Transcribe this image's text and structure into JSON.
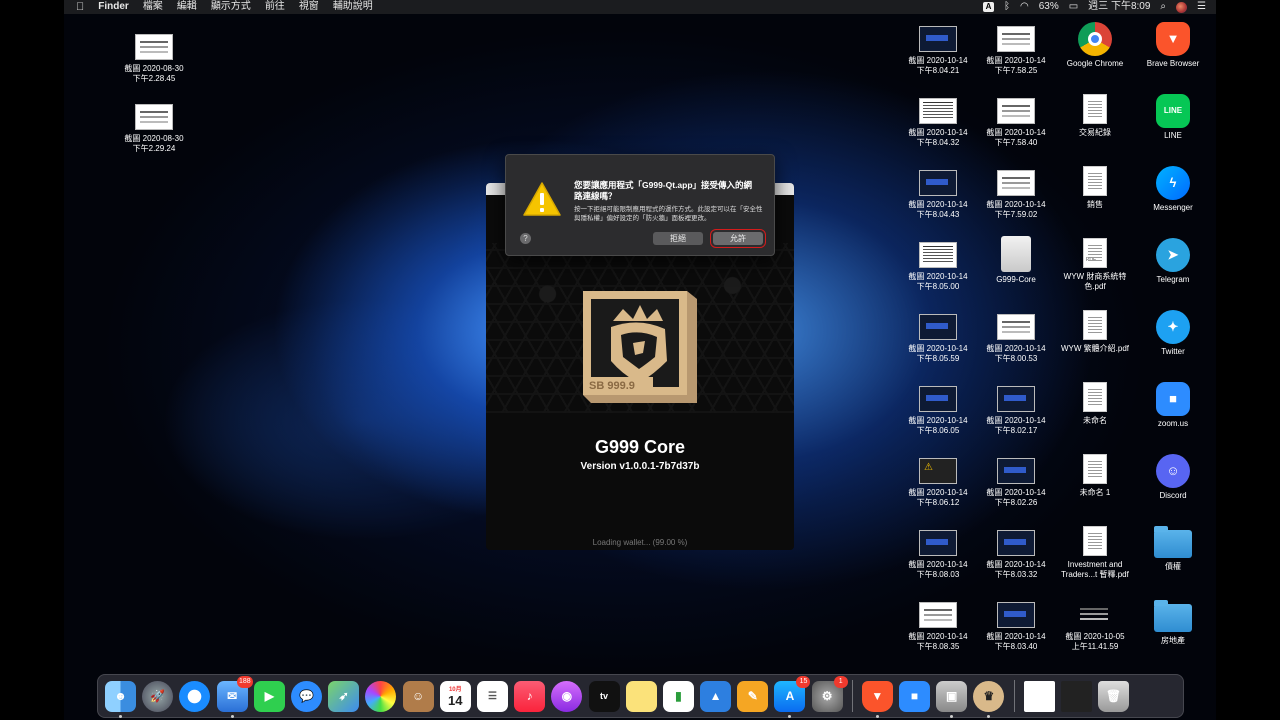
{
  "menubar": {
    "apple": "",
    "app_name": "Finder",
    "items": [
      "檔案",
      "編輯",
      "顯示方式",
      "前往",
      "視窗",
      "輔助說明"
    ],
    "input_source": "A",
    "battery": "63%",
    "clock": "週三 下午8:09"
  },
  "desktop_left": [
    {
      "line1": "截圖 2020-08-30",
      "line2": "下午2.28.45"
    },
    {
      "line1": "截圖 2020-08-30",
      "line2": "下午2.29.24"
    }
  ],
  "desktop_col1": [
    {
      "line1": "截圖 2020-10-14",
      "line2": "下午8.04.21"
    },
    {
      "line1": "截圖 2020-10-14",
      "line2": "下午8.04.32"
    },
    {
      "line1": "截圖 2020-10-14",
      "line2": "下午8.04.43"
    },
    {
      "line1": "截圖 2020-10-14",
      "line2": "下午8.05.00"
    },
    {
      "line1": "截圖 2020-10-14",
      "line2": "下午8.05.59"
    },
    {
      "line1": "截圖 2020-10-14",
      "line2": "下午8.06.05"
    },
    {
      "line1": "截圖 2020-10-14",
      "line2": "下午8.06.12"
    },
    {
      "line1": "截圖 2020-10-14",
      "line2": "下午8.08.03"
    },
    {
      "line1": "截圖 2020-10-14",
      "line2": "下午8.08.35"
    }
  ],
  "desktop_col2": [
    {
      "line1": "截圖 2020-10-14",
      "line2": "下午7.58.25"
    },
    {
      "line1": "截圖 2020-10-14",
      "line2": "下午7.58.40"
    },
    {
      "line1": "截圖 2020-10-14",
      "line2": "下午7.59.02"
    },
    {
      "line1": "G999-Core",
      "line2": ""
    },
    {
      "line1": "截圖 2020-10-14",
      "line2": "下午8.00.53"
    },
    {
      "line1": "截圖 2020-10-14",
      "line2": "下午8.02.17"
    },
    {
      "line1": "截圖 2020-10-14",
      "line2": "下午8.02.26"
    },
    {
      "line1": "截圖 2020-10-14",
      "line2": "下午8.03.32"
    },
    {
      "line1": "截圖 2020-10-14",
      "line2": "下午8.03.40"
    }
  ],
  "desktop_col3": [
    {
      "line1": "Google Chrome",
      "line2": ""
    },
    {
      "line1": "交易紀錄",
      "line2": ""
    },
    {
      "line1": "銷售",
      "line2": ""
    },
    {
      "line1": "WYW 財商系統特",
      "line2": "色.pdf",
      "badge": "PDF"
    },
    {
      "line1": "WYW 繁體介紹.pdf",
      "line2": ""
    },
    {
      "line1": "未命名",
      "line2": ""
    },
    {
      "line1": "未命名 1",
      "line2": ""
    },
    {
      "line1": "Investment and",
      "line2": "Traders...t 暫釋.pdf"
    },
    {
      "line1": "截圖 2020-10-05",
      "line2": "上午11.41.59"
    }
  ],
  "desktop_col4": [
    {
      "line1": "Brave Browser",
      "line2": ""
    },
    {
      "line1": "LINE",
      "line2": "",
      "glyph": "LINE"
    },
    {
      "line1": "Messenger",
      "line2": ""
    },
    {
      "line1": "Telegram",
      "line2": ""
    },
    {
      "line1": "Twitter",
      "line2": ""
    },
    {
      "line1": "zoom.us",
      "line2": ""
    },
    {
      "line1": "Discord",
      "line2": ""
    },
    {
      "line1": "債權",
      "line2": ""
    },
    {
      "line1": "房地產",
      "line2": ""
    }
  ],
  "splash": {
    "logo_text": "SB 999.9",
    "title": "G999 Core",
    "version": "Version v1.0.0.1-7b7d37b",
    "loading": "Loading wallet... (99.00 %)"
  },
  "dialog": {
    "question": "您要讓應用程式「G999-Qt.app」接受傳入的網路連線嗎？",
    "message": "按一下拒絕可能限制應用程式的運作方式。此設定可以在「安全性與隱私權」偏好設定的「防火牆」面板裡更改。",
    "help": "?",
    "deny_label": "拒絕",
    "allow_label": "允許"
  },
  "dock": {
    "mail_badge": "188",
    "calendar_month": "10月",
    "calendar_day": "14",
    "appletv_label": "tv",
    "appstore_badge": "15",
    "prefs_badge": "1"
  },
  "colors": {
    "menubar_bg": "#1b1c1f",
    "dialog_bg": "#2c2c2e",
    "allow_highlight": "#d41c1c",
    "logo_gold": "#d9b98a"
  }
}
